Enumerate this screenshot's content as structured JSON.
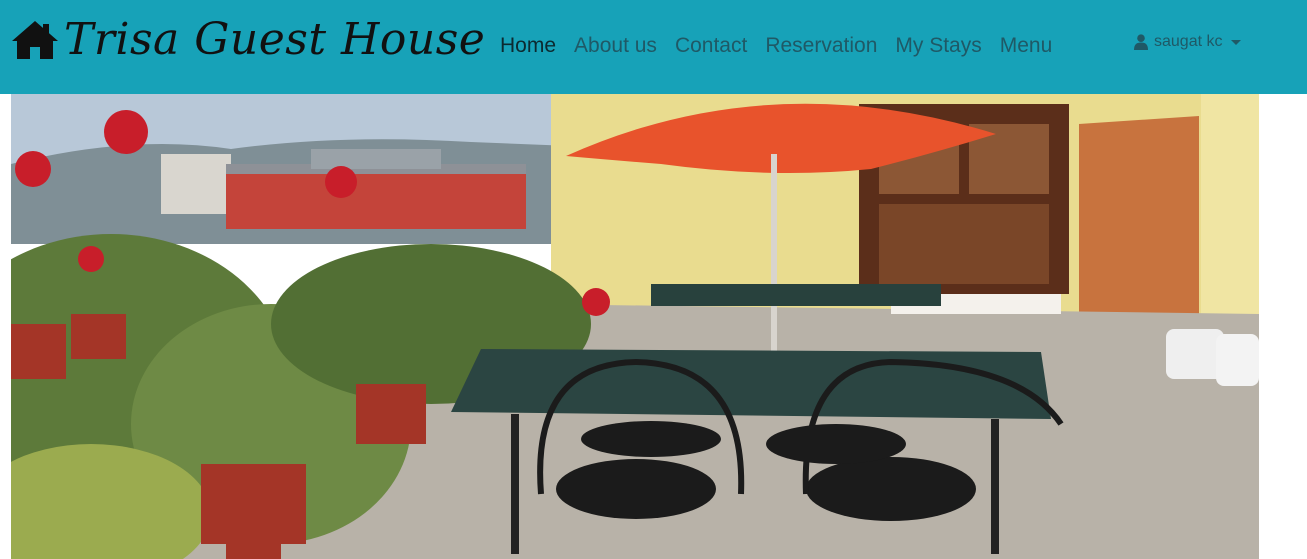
{
  "brand": {
    "title": "Trisa Guest House",
    "icon": "home-icon"
  },
  "nav": {
    "items": [
      {
        "label": "Home",
        "active": true
      },
      {
        "label": "About us"
      },
      {
        "label": "Contact"
      },
      {
        "label": "Reservation"
      },
      {
        "label": "My Stays"
      },
      {
        "label": "Menu"
      }
    ]
  },
  "user": {
    "name": "saugat kc",
    "icon": "user-icon"
  },
  "colors": {
    "navbar": "#17a2b8",
    "nav_link": "#1f5966",
    "nav_active": "#0c2a30"
  }
}
